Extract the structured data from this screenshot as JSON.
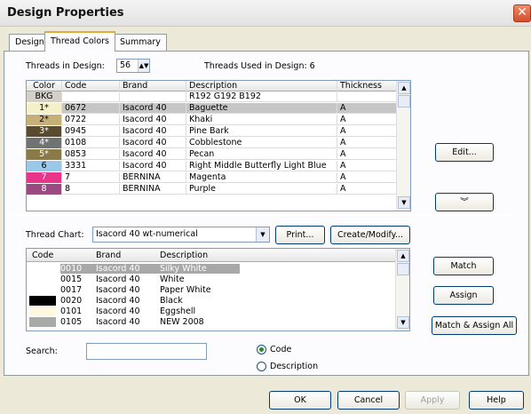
{
  "window": {
    "title": "Design Properties"
  },
  "tabs": [
    {
      "label": "Design",
      "active": false
    },
    {
      "label": "Thread Colors",
      "active": true
    },
    {
      "label": "Summary",
      "active": false
    }
  ],
  "threads": {
    "count_label": "Threads in Design:",
    "count_value": "56",
    "used_label": "Threads Used in Design: 6"
  },
  "thread_table": {
    "headers": [
      "Color",
      "Code",
      "Brand",
      "Description",
      "Thickness"
    ],
    "rows": [
      {
        "color_label": "BKG",
        "swatch": "#d4d0c8",
        "label_color": "#000000",
        "code": "",
        "brand": "",
        "description": "R192 G192 B192",
        "thickness": ""
      },
      {
        "color_label": "1*",
        "swatch": "#f4f1c9",
        "label_color": "#000000",
        "code": "0672",
        "brand": "Isacord 40",
        "description": "Baguette",
        "thickness": "A",
        "selected": true
      },
      {
        "color_label": "2*",
        "swatch": "#c7b078",
        "label_color": "#000000",
        "code": "0722",
        "brand": "Isacord 40",
        "description": "Khaki",
        "thickness": "A"
      },
      {
        "color_label": "3*",
        "swatch": "#5a4a30",
        "label_color": "#ffffff",
        "code": "0945",
        "brand": "Isacord 40",
        "description": "Pine Bark",
        "thickness": "A"
      },
      {
        "color_label": "4*",
        "swatch": "#6f7472",
        "label_color": "#ffffff",
        "code": "0108",
        "brand": "Isacord 40",
        "description": "Cobblestone",
        "thickness": "A"
      },
      {
        "color_label": "5*",
        "swatch": "#8a7a48",
        "label_color": "#ffffff",
        "code": "0853",
        "brand": "Isacord 40",
        "description": "Pecan",
        "thickness": "A"
      },
      {
        "color_label": "6",
        "swatch": "#9ac8e8",
        "label_color": "#000000",
        "code": "3331",
        "brand": "Isacord 40",
        "description": "Right Middle Butterfly Light Blue",
        "thickness": "A"
      },
      {
        "color_label": "7",
        "swatch": "#e8358a",
        "label_color": "#ffffff",
        "code": "7",
        "brand": "BERNINA",
        "description": "Magenta",
        "thickness": "A"
      },
      {
        "color_label": "8",
        "swatch": "#9a4a80",
        "label_color": "#ffffff",
        "code": "8",
        "brand": "BERNINA",
        "description": "Purple",
        "thickness": "A"
      }
    ]
  },
  "buttons": {
    "edit": "Edit...",
    "expand": "»",
    "print": "Print...",
    "create_modify": "Create/Modify...",
    "match": "Match",
    "assign": "Assign",
    "match_assign_all": "Match & Assign All",
    "ok": "OK",
    "cancel": "Cancel",
    "apply": "Apply",
    "help": "Help"
  },
  "thread_chart": {
    "label": "Thread Chart:",
    "selected": "Isacord 40 wt-numerical"
  },
  "chart_list": {
    "headers": [
      "Code",
      "Brand",
      "Description"
    ],
    "rows": [
      {
        "swatch": "#ffffff",
        "code": "0010",
        "brand": "Isacord 40",
        "description": "Silky White",
        "selected": true
      },
      {
        "swatch": "#ffffff",
        "code": "0015",
        "brand": "Isacord 40",
        "description": "White"
      },
      {
        "swatch": "#ffffff",
        "code": "0017",
        "brand": "Isacord 40",
        "description": "Paper White"
      },
      {
        "swatch": "#000000",
        "code": "0020",
        "brand": "Isacord 40",
        "description": "Black"
      },
      {
        "swatch": "#fff7df",
        "code": "0101",
        "brand": "Isacord 40",
        "description": "Eggshell"
      },
      {
        "swatch": "#a8aaa8",
        "code": "0105",
        "brand": "Isacord 40",
        "description": "NEW 2008"
      }
    ]
  },
  "search": {
    "label": "Search:",
    "value": ""
  },
  "radios": {
    "code": "Code",
    "description": "Description"
  }
}
